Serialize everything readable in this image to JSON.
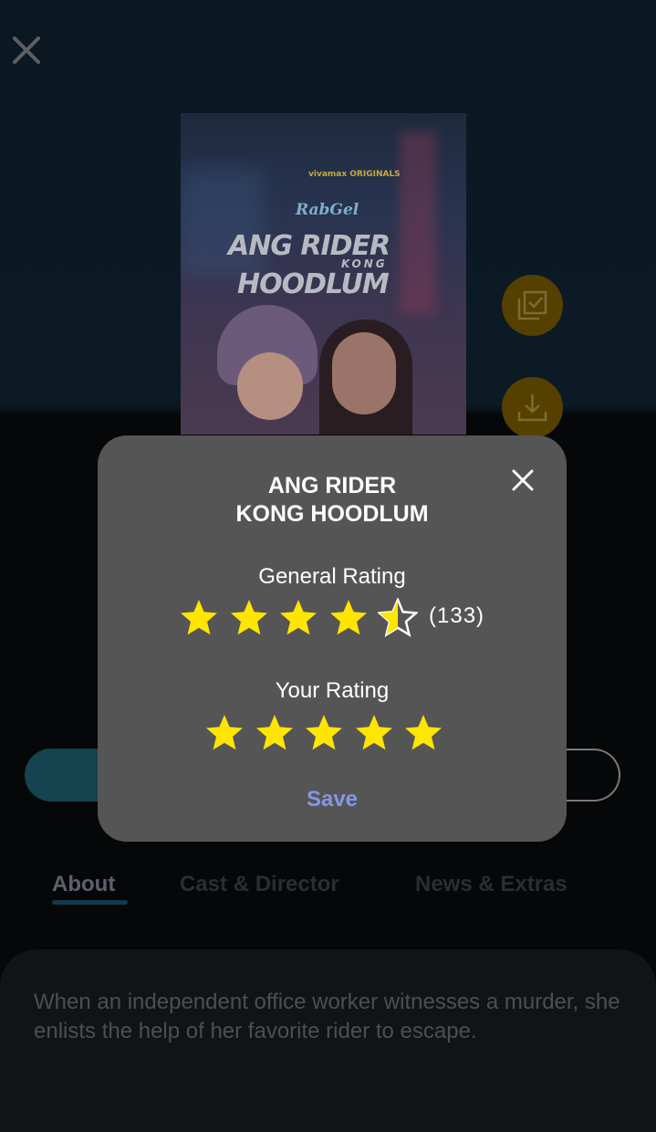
{
  "modal": {
    "title_line1": "ANG RIDER",
    "title_line2": "KONG HOODLUM",
    "general_rating_label": "General Rating",
    "general_rating_value": 4.5,
    "general_rating_count": "(133)",
    "your_rating_label": "Your Rating",
    "your_rating_value": 5,
    "save_label": "Save"
  },
  "poster": {
    "brand_small": "vivamax ORIGINALS",
    "brand_script": "RabGel",
    "title_word1": "ANG RIDER",
    "title_word2": "KONG",
    "title_word3": "HOODLUM"
  },
  "tabs": [
    "About",
    "Cast & Director",
    "News & Extras"
  ],
  "about_text": "When an independent office worker witnesses a murder, she enlists the help of her favorite rider to escape.",
  "icons": {
    "top_close": "close-icon",
    "watchlist": "watchlist-check-icon",
    "download": "download-icon",
    "star": "star-icon"
  },
  "colors": {
    "star": "#FFE500",
    "save": "#8596E3",
    "modal_bg": "#555555",
    "side_button": "#564000"
  }
}
